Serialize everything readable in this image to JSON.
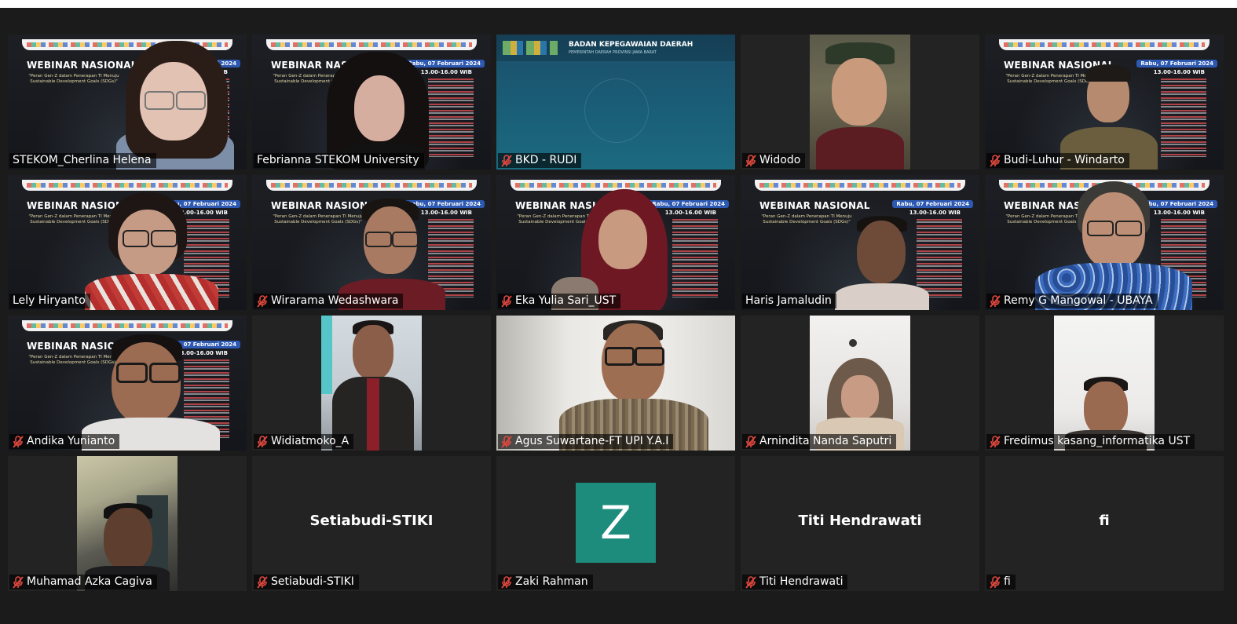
{
  "slide": {
    "title": "WEBINAR NASIONAL",
    "subtitle": "\"Peran Gen-Z dalam Penerapan TI Menuju Sustainable Development Goals (SDGs)\"",
    "date": "Rabu, 07 Februari 2024",
    "time": "13.00-16.00 WIB"
  },
  "bkd": {
    "header": "BADAN KEPEGAWAIAN DAERAH",
    "subheader": "PEMERINTAH DAERAH PROVINSI JAWA BARAT"
  },
  "participants": [
    {
      "name": "STEKOM_Cherlina Helena",
      "muted": false
    },
    {
      "name": "Febrianna STEKOM University",
      "muted": false,
      "speaking": true
    },
    {
      "name": "BKD - RUDI",
      "muted": true
    },
    {
      "name": "Widodo",
      "muted": true
    },
    {
      "name": "Budi-Luhur - Windarto",
      "muted": true
    },
    {
      "name": "Lely Hiryanto",
      "muted": false
    },
    {
      "name": "Wirarama Wedashwara",
      "muted": true
    },
    {
      "name": "Eka Yulia Sari_UST",
      "muted": true
    },
    {
      "name": "Haris Jamaludin",
      "muted": false
    },
    {
      "name": "Remy G Mangowal - UBAYA",
      "muted": true
    },
    {
      "name": "Andika Yunianto",
      "muted": true
    },
    {
      "name": "Widiatmoko_A",
      "muted": true
    },
    {
      "name": "Agus Suwartane-FT UPI Y.A.I",
      "muted": true
    },
    {
      "name": "Arnindita Nanda Saputri",
      "muted": true
    },
    {
      "name": "Fredimus kasang_informatika UST",
      "muted": true
    },
    {
      "name": "Muhamad Azka Cagiva",
      "muted": true
    },
    {
      "name": "Setiabudi-STIKI",
      "muted": true,
      "display_name": "Setiabudi-STIKI"
    },
    {
      "name": "Zaki Rahman",
      "muted": true,
      "avatar_letter": "Z"
    },
    {
      "name": "Titi Hendrawati",
      "muted": true,
      "display_name": "Titi Hendrawati"
    },
    {
      "name": "fi",
      "muted": true,
      "display_name": "fi"
    }
  ],
  "colors": {
    "background": "#1b1b1b",
    "tile": "#232323",
    "active_speaker_border": "#d6e76a",
    "muted_icon": "#e0483e",
    "avatar": "#1d8c7c",
    "slide_date_badge": "#2d59b3"
  },
  "icons": {
    "muted": "mic-muted-icon"
  }
}
